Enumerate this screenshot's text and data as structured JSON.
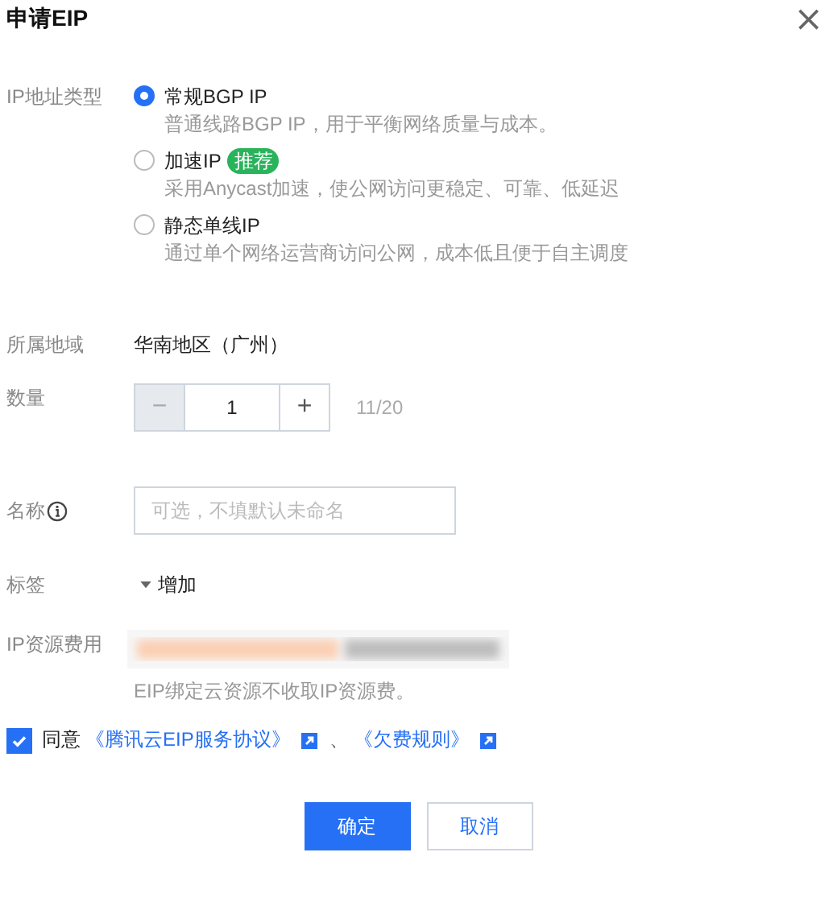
{
  "dialog": {
    "title": "申请EIP",
    "close": "×"
  },
  "ip_type": {
    "label": "IP地址类型",
    "options": [
      {
        "title": "常规BGP IP",
        "description": "普通线路BGP IP，用于平衡网络质量与成本。",
        "selected": true
      },
      {
        "title": "加速IP",
        "badge": "推荐",
        "description": "采用Anycast加速，使公网访问更稳定、可靠、低延迟",
        "selected": false
      },
      {
        "title": "静态单线IP",
        "description": "通过单个网络运营商访问公网，成本低且便于自主调度",
        "selected": false
      }
    ]
  },
  "region": {
    "label": "所属地域",
    "value": "华南地区（广州）"
  },
  "quantity": {
    "label": "数量",
    "minus": "−",
    "value": "1",
    "plus": "+",
    "minus_disabled": true,
    "quota": "11/20"
  },
  "name": {
    "label": "名称",
    "placeholder": "可选，不填默认未命名"
  },
  "tags": {
    "label": "标签",
    "action": "增加"
  },
  "fee": {
    "label": "IP资源费用",
    "note": "EIP绑定云资源不收取IP资源费。"
  },
  "agreement": {
    "checked": true,
    "text": "同意",
    "links": [
      "《腾讯云EIP服务协议》",
      "《欠费规则》"
    ],
    "separator": "、"
  },
  "buttons": [
    {
      "label": "确定",
      "kind": "primary"
    },
    {
      "label": "取消",
      "kind": "secondary"
    }
  ]
}
